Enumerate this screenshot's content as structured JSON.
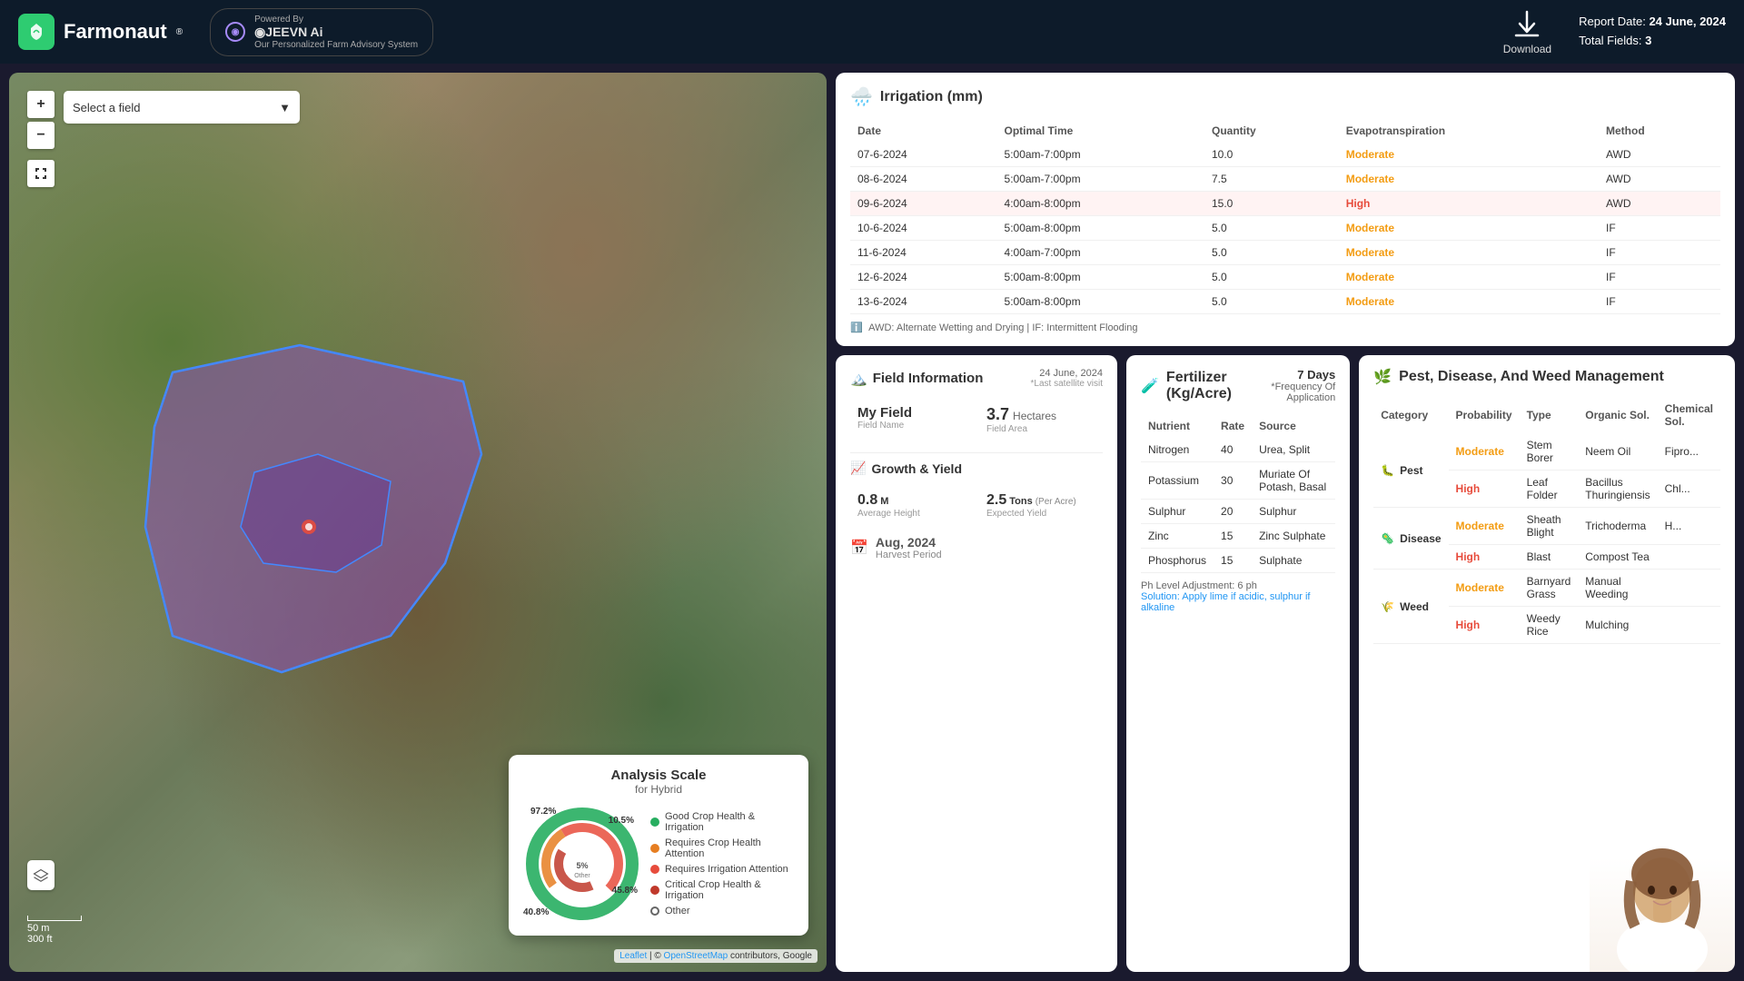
{
  "header": {
    "logo": "F",
    "brand": "Farmonaut",
    "reg": "®",
    "powered_by": "Powered By",
    "jeevn_name": "◉JEEVN Ai",
    "advisory": "Our Personalized Farm Advisory System",
    "download_label": "Download",
    "report_date_label": "Report Date:",
    "report_date": "24 June, 2024",
    "total_fields_label": "Total Fields:",
    "total_fields": "3"
  },
  "map": {
    "field_select_placeholder": "Select a field",
    "zoom_in": "+",
    "zoom_out": "−",
    "scale_m": "50 m",
    "scale_ft": "300 ft",
    "attribution_leaflet": "Leaflet",
    "attribution_osm": "OpenStreetMap",
    "attribution_rest": " contributors, Google"
  },
  "analysis_scale": {
    "title": "Analysis Scale",
    "subtitle": "for Hybrid",
    "segments": [
      {
        "label": "Good Crop Health & Irrigation",
        "color": "#27ae60",
        "pct": 97.2,
        "display": "97.2%"
      },
      {
        "label": "Requires Crop Health Attention",
        "color": "#e67e22",
        "pct": 10.5,
        "display": "10.5%"
      },
      {
        "label": "Requires Irrigation Attention",
        "color": "#e74c3c",
        "pct": 45.8,
        "display": "45.8%"
      },
      {
        "label": "Critical Crop Health & Irrigation",
        "color": "#c0392b",
        "pct": 40.8,
        "display": "40.8%"
      },
      {
        "label": "Other",
        "color": "transparent",
        "pct": 5,
        "display": "5% Other"
      }
    ]
  },
  "irrigation": {
    "title": "Irrigation (mm)",
    "columns": [
      "Date",
      "Optimal Time",
      "Quantity",
      "Evapotranspiration",
      "Method"
    ],
    "rows": [
      {
        "date": "07-6-2024",
        "time": "5:00am-7:00pm",
        "qty": "10.0",
        "evapo": "Moderate",
        "method": "AWD",
        "highlight": false
      },
      {
        "date": "08-6-2024",
        "time": "5:00am-7:00pm",
        "qty": "7.5",
        "evapo": "Moderate",
        "method": "AWD",
        "highlight": false
      },
      {
        "date": "09-6-2024",
        "time": "4:00am-8:00pm",
        "qty": "15.0",
        "evapo": "High",
        "method": "AWD",
        "highlight": true
      },
      {
        "date": "10-6-2024",
        "time": "5:00am-8:00pm",
        "qty": "5.0",
        "evapo": "Moderate",
        "method": "IF",
        "highlight": false
      },
      {
        "date": "11-6-2024",
        "time": "4:00am-7:00pm",
        "qty": "5.0",
        "evapo": "Moderate",
        "method": "IF",
        "highlight": false
      },
      {
        "date": "12-6-2024",
        "time": "5:00am-8:00pm",
        "qty": "5.0",
        "evapo": "Moderate",
        "method": "IF",
        "highlight": false
      },
      {
        "date": "13-6-2024",
        "time": "5:00am-8:00pm",
        "qty": "5.0",
        "evapo": "Moderate",
        "method": "IF",
        "highlight": false
      }
    ],
    "note": "AWD: Alternate Wetting and Drying | IF: Intermittent Flooding"
  },
  "field_info": {
    "title": "Field Information",
    "title_icon": "🏔️",
    "date": "24 June, 2024",
    "last_visit": "*Last satellite visit",
    "field_name_label": "Field Name",
    "field_name": "My Field",
    "field_area_label": "Field Area",
    "field_area_value": "3.7",
    "field_area_unit": "Hectares",
    "growth_title": "Growth & Yield",
    "growth_icon": "📈",
    "height_value": "0.8",
    "height_unit": "M",
    "height_label": "Average Height",
    "yield_value": "2.5",
    "yield_unit": "Tons",
    "yield_per": "(Per Acre)",
    "yield_label": "Expected Yield",
    "harvest_icon": "📅",
    "harvest_date": "Aug, 2024",
    "harvest_label": "Harvest Period"
  },
  "fertilizer": {
    "title": "Fertilizer (Kg/Acre)",
    "icon": "🧪",
    "freq_days": "7 Days",
    "freq_label": "*Frequency Of Application",
    "columns": [
      "Nutrient",
      "Rate",
      "Source"
    ],
    "rows": [
      {
        "nutrient": "Nitrogen",
        "rate": "40",
        "source": "Urea, Split"
      },
      {
        "nutrient": "Potassium",
        "rate": "30",
        "source": "Muriate Of Potash, Basal"
      },
      {
        "nutrient": "Sulphur",
        "rate": "20",
        "source": "Sulphur"
      },
      {
        "nutrient": "Zinc",
        "rate": "15",
        "source": "Zinc Sulphate"
      },
      {
        "nutrient": "Phosphorus",
        "rate": "15",
        "source": "Sulphate"
      }
    ],
    "ph_note": "Ph Level Adjustment: 6 ph",
    "solution": "Solution: Apply lime if acidic, sulphur if alkaline"
  },
  "pest": {
    "title": "Pest, Disease, And Weed Management",
    "icon": "🌿",
    "columns": [
      "Category",
      "Probability",
      "Type",
      "Organic Sol.",
      "Chemical Sol."
    ],
    "groups": [
      {
        "category": "Pest",
        "icon": "🐛",
        "rows": [
          {
            "prob": "Moderate",
            "type": "Stem Borer",
            "organic": "Neem Oil",
            "chemical": "Fipro..."
          },
          {
            "prob": "High",
            "type": "Leaf Folder",
            "organic": "Bacillus Thuringiensis",
            "chemical": "Chl..."
          }
        ]
      },
      {
        "category": "Disease",
        "icon": "🦠",
        "rows": [
          {
            "prob": "Moderate",
            "type": "Sheath Blight",
            "organic": "Trichoderma",
            "chemical": "H..."
          },
          {
            "prob": "High",
            "type": "Blast",
            "organic": "Compost Tea",
            "chemical": ""
          }
        ]
      },
      {
        "category": "Weed",
        "icon": "🌾",
        "rows": [
          {
            "prob": "Moderate",
            "type": "Barnyard Grass",
            "organic": "Manual Weeding",
            "chemical": ""
          },
          {
            "prob": "High",
            "type": "Weedy Rice",
            "organic": "Mulching",
            "chemical": ""
          }
        ]
      }
    ]
  },
  "colors": {
    "good_green": "#27ae60",
    "orange": "#e67e22",
    "red": "#e74c3c",
    "dark_red": "#c0392b",
    "high_red": "#e74c3c",
    "moderate_orange": "#f39c12",
    "highlight_bg": "#fff3f3",
    "accent_blue": "#2196F3"
  }
}
